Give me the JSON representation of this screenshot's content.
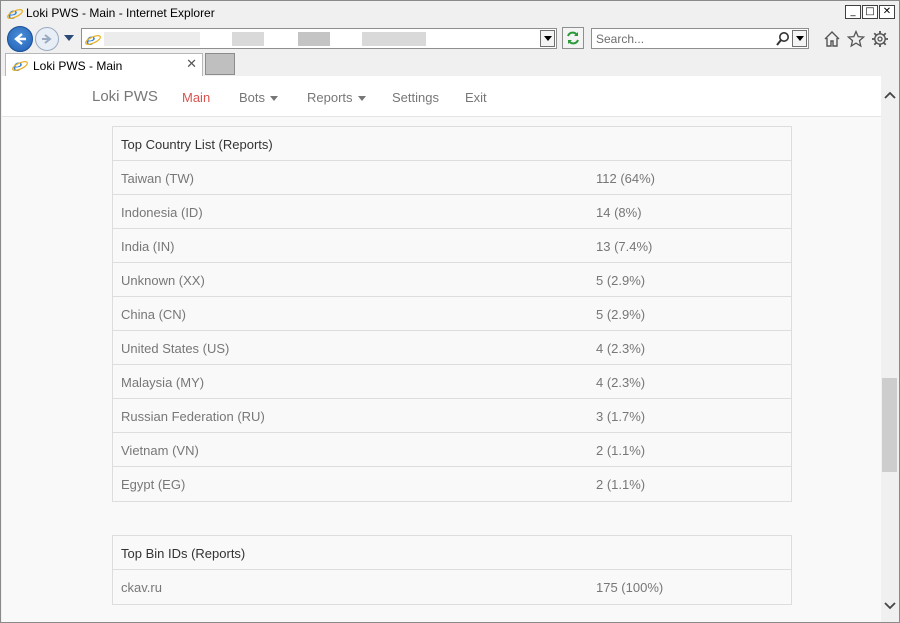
{
  "window": {
    "title": "Loki PWS - Main - Internet Explorer",
    "controls": {
      "minimize": "_",
      "maximize": "□",
      "close": "✕"
    }
  },
  "browser": {
    "search_placeholder": "Search...",
    "tab_label": "Loki PWS - Main",
    "tab_close": "✕"
  },
  "app": {
    "brand": "Loki PWS",
    "nav": [
      {
        "label": "Main",
        "active": true
      },
      {
        "label": "Bots",
        "dropdown": true
      },
      {
        "label": "Reports",
        "dropdown": true
      },
      {
        "label": "Settings"
      },
      {
        "label": "Exit"
      }
    ]
  },
  "panels": {
    "country": {
      "title": "Top Country List (Reports)",
      "rows": [
        {
          "name": "Taiwan (TW)",
          "count": "112 (64%)"
        },
        {
          "name": "Indonesia (ID)",
          "count": "14 (8%)"
        },
        {
          "name": "India (IN)",
          "count": "13 (7.4%)"
        },
        {
          "name": "Unknown (XX)",
          "count": "5 (2.9%)"
        },
        {
          "name": "China (CN)",
          "count": "5 (2.9%)"
        },
        {
          "name": "United States (US)",
          "count": "4 (2.3%)"
        },
        {
          "name": "Malaysia (MY)",
          "count": "4 (2.3%)"
        },
        {
          "name": "Russian Federation (RU)",
          "count": "3 (1.7%)"
        },
        {
          "name": "Vietnam (VN)",
          "count": "2 (1.1%)"
        },
        {
          "name": "Egypt (EG)",
          "count": "2 (1.1%)"
        }
      ]
    },
    "bins": {
      "title": "Top Bin IDs (Reports)",
      "rows": [
        {
          "name": "ckav.ru",
          "count": "175 (100%)"
        }
      ]
    }
  },
  "colors": {
    "active_nav": "#d9534f",
    "muted_text": "#777777",
    "border": "#dddddd"
  }
}
